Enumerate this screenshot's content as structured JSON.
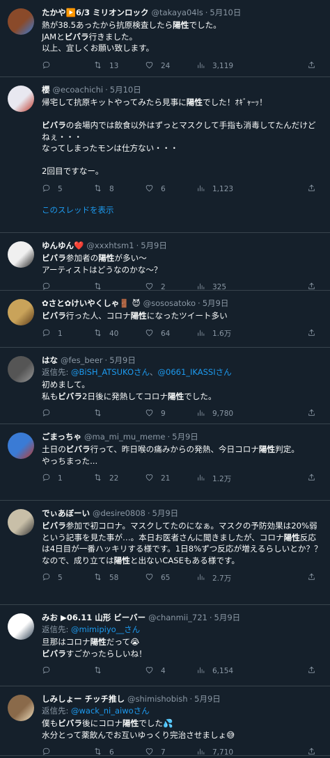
{
  "tweets": [
    {
      "name": "たかや▶️6/3 ミリオンロック",
      "handle": "@takaya04ls",
      "date": "5月10日",
      "body_html": "熱が38.5あったから抗原検査したら<b>陽性</b>でした。\nJAMと<b>ビバラ</b>行きました。\n以上、宜しくお願い致します。",
      "reply_to": "",
      "retweets": "13",
      "likes": "24",
      "views": "3,119",
      "avatar_colors": [
        "#8a4a2a",
        "#3a7bd5"
      ]
    },
    {
      "name": "櫻",
      "handle": "@ecoachichi",
      "date": "5月10日",
      "body_html": "帰宅して抗原キットやってみたら見事に<b>陽性</b>でした！ｵｷﾞｬｰｯ！\n\n<b>ビバラ</b>の会場内では飲食以外はずっとマスクして手指も消毒してたんだけどねぇ・・・\nなってしまったモンは仕方ない・・・\n\n2回目ですなー。",
      "reply_to": "",
      "replies": "5",
      "retweets": "8",
      "likes": "6",
      "views": "1,123",
      "thread_link": "このスレッドを表示",
      "avatar_colors": [
        "#e8e8f0",
        "#c0392b"
      ]
    },
    {
      "name": "ゆんゆん❤️",
      "handle": "@xxxhtsm1",
      "date": "5月9日",
      "body_html": "<b>ビバラ</b>参加者の<b>陽性</b>が多い〜\nアーティストはどうなのかな〜？",
      "reply_to": "",
      "likes": "2",
      "views": "325",
      "avatar_colors": [
        "#f0f0f0",
        "#222222"
      ]
    },
    {
      "name": "✿さと✿けいやくしゃ🚪 😈",
      "handle": "@sososatoko",
      "date": "5月9日",
      "body_html": "<b>ビバラ</b>行った人、コロナ<b>陽性</b>になったツイート多い",
      "reply_to": "",
      "replies": "1",
      "retweets": "40",
      "likes": "64",
      "views": "1.6万",
      "avatar_colors": [
        "#c9a35a",
        "#5a3a1a"
      ]
    },
    {
      "name": "はな",
      "handle": "@fes_beer",
      "date": "5月9日",
      "reply_prefix": "返信先: ",
      "reply_mentions": [
        "@BiSH_ATSUKOさん",
        "@0661_IKASSIさん"
      ],
      "body_html": "初めまして。\n私も<b>ビバラ</b>2日後に発熱してコロナ<b>陽性</b>でした。",
      "likes": "9",
      "views": "9,780",
      "avatar_colors": [
        "#555555",
        "#999999"
      ]
    },
    {
      "name": "ごまっちゃ",
      "handle": "@ma_mi_mu_meme",
      "date": "5月9日",
      "body_html": "土日の<b>ビバラ</b>行って、昨日喉の痛みからの発熱、今日コロナ<b>陽性</b>判定。\nやっちまった...",
      "reply_to": "",
      "replies": "1",
      "retweets": "22",
      "likes": "21",
      "views": "1.2万",
      "avatar_colors": [
        "#3a7bd5",
        "#c0392b"
      ]
    },
    {
      "name": "でぃあぼーい",
      "handle": "@desire0808",
      "date": "5月9日",
      "body_html": "<b>ビバラ</b>参加で初コロナ。マスクしてたのになぁ。マスクの予防効果は20%弱という記事を見た事が…。本日お医者さんに聞きましたが、コロナ<b>陽性</b>反応は4日目が一番ハッキリする様です。1日8%ずつ反応が増えるらしいとか？？なので、成り立ては<b>陽性</b>と出ないCASEもある様です。",
      "reply_to": "",
      "replies": "5",
      "retweets": "58",
      "likes": "65",
      "views": "2.7万",
      "avatar_colors": [
        "#c8bfa8",
        "#333333"
      ]
    },
    {
      "name": "みお ▶06.11 山形 ビーバー",
      "handle": "@chanmii_721",
      "date": "5月9日",
      "reply_prefix": "返信先: ",
      "reply_mentions": [
        "@mimipiyo__さん"
      ],
      "body_html": "旦那はコロナ<b>陽性</b>だって😭\n<b>ビバラ</b>すごかったらしいね！",
      "likes": "4",
      "views": "6,154",
      "avatar_colors": [
        "#ffffff",
        "#2c3e50"
      ]
    },
    {
      "name": "しみしょー チッチ推し",
      "handle": "@shimishobish",
      "date": "5月9日",
      "reply_prefix": "返信先: ",
      "reply_mentions": [
        "@wack_ni_aiwoさん"
      ],
      "body_html": "僕も<b>ビバラ</b>後にコロナ<b>陽性</b>でした💦\n水分とって薬飲んでお互いゆっくり完治させましょ😅",
      "retweets": "6",
      "likes": "7",
      "views": "7,710",
      "avatar_colors": [
        "#8a6a4a",
        "#f0e0c0"
      ]
    }
  ]
}
